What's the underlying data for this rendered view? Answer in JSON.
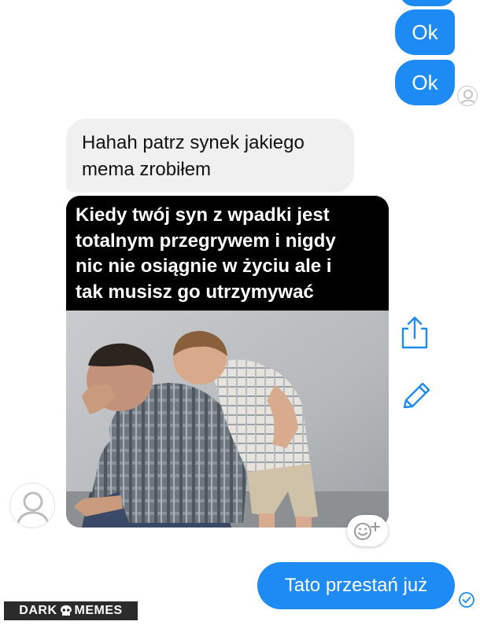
{
  "messages": {
    "outgoing_ok_1": "Ok",
    "outgoing_ok_2": "Ok",
    "incoming_text_line1": "Hahah patrz synek jakiego",
    "incoming_text_line2": "mema zrobiłem",
    "outgoing_final": "Tato przestań już"
  },
  "meme": {
    "caption_lines": [
      "Kiedy twój syn z wpadki jest",
      "totalnym przegrywem i nigdy",
      "nic nie osiągnie w życiu ale i",
      "tak musisz go utrzymywać"
    ]
  },
  "watermark": {
    "left": "DARK",
    "right": "MEMES"
  },
  "colors": {
    "outgoing_bubble": "#1e8bf5",
    "incoming_bubble": "#f0f0f0",
    "icon_blue": "#1e8bf5"
  },
  "icons": [
    "share-icon",
    "edit-icon",
    "emoji-reaction-icon",
    "delivered-check-icon",
    "default-avatar-icon"
  ]
}
